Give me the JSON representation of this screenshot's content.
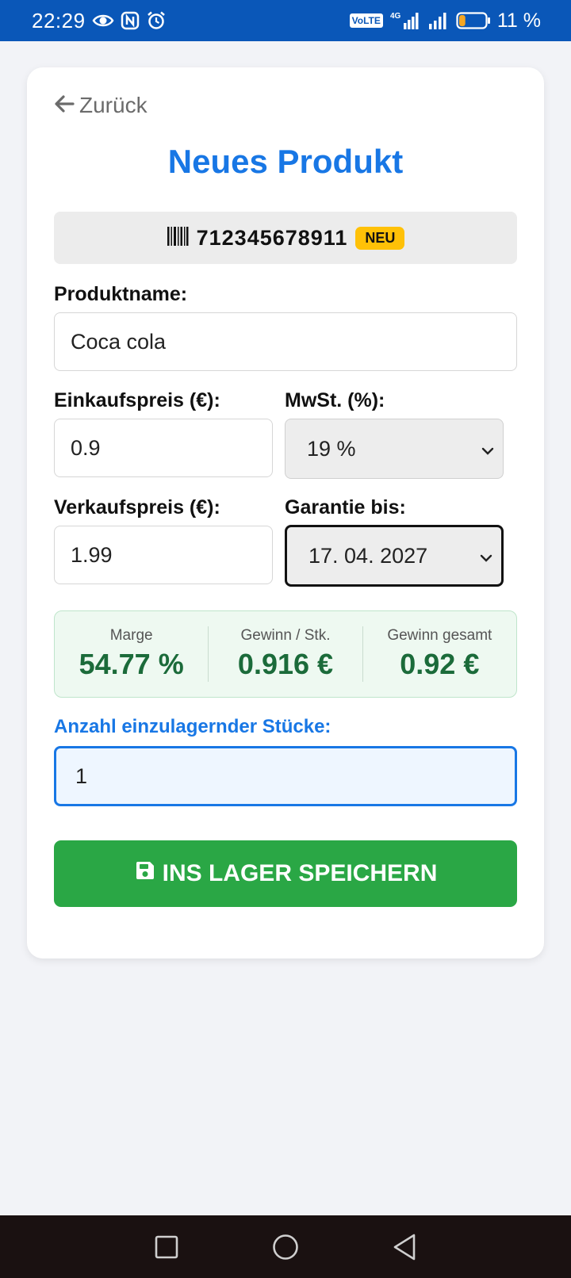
{
  "status_bar": {
    "time": "22:29",
    "battery_percent": "11 %",
    "battery_level": 0.11,
    "icons": [
      "eye-icon",
      "nfc-icon",
      "alarm-icon",
      "volte-icon",
      "signal-4g-icon",
      "signal-icon",
      "battery-icon"
    ],
    "volte_label": "VoLTE",
    "network_label": "4G"
  },
  "header": {
    "back_label": "Zurück",
    "title": "Neues Produkt"
  },
  "barcode": {
    "number": "712345678911",
    "badge": "NEU"
  },
  "form": {
    "product_name_label": "Produktname:",
    "product_name_value": "Coca cola",
    "purchase_price_label": "Einkaufspreis (€):",
    "purchase_price_value": "0.9",
    "vat_label": "MwSt. (%):",
    "vat_value": "19 %",
    "sale_price_label": "Verkaufspreis (€):",
    "sale_price_value": "1.99",
    "warranty_label": "Garantie bis:",
    "warranty_value": "17. 04. 2027"
  },
  "stats": {
    "margin_label": "Marge",
    "margin_value": "54.77 %",
    "profit_unit_label": "Gewinn / Stk.",
    "profit_unit_value": "0.916 €",
    "profit_total_label": "Gewinn gesamt",
    "profit_total_value": "0.92 €"
  },
  "quantity": {
    "label": "Anzahl einzulagernder Stücke:",
    "value": "1"
  },
  "save_button": {
    "label": "INS LAGER SPEICHERN"
  },
  "colors": {
    "status_bar": "#0a57b8",
    "accent": "#1877e5",
    "success": "#2aa745",
    "stat_text": "#1b6b3a",
    "badge": "#ffc107",
    "nav_bar": "#1a1111"
  }
}
